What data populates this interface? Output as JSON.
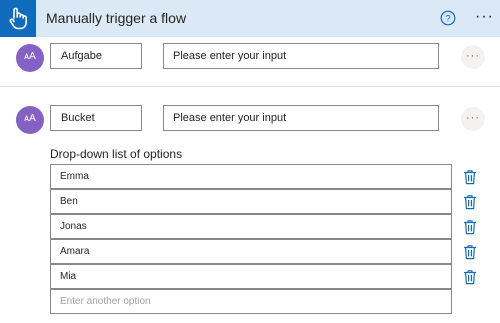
{
  "header": {
    "title": "Manually trigger a flow",
    "trigger_icon": "touch-hand-icon",
    "help_icon": "help-circle-icon",
    "more_label": "···"
  },
  "inputs": [
    {
      "avatar_text": "ᴀA",
      "label": "Aufgabe",
      "placeholder": "Please enter your input",
      "more_label": "···"
    },
    {
      "avatar_text": "ᴀA",
      "label": "Bucket",
      "placeholder": "Please enter your input",
      "more_label": "···"
    }
  ],
  "dropdown": {
    "heading": "Drop-down list of options",
    "options": [
      "Emma",
      "Ben",
      "Jonas",
      "Amara",
      "Mia"
    ],
    "new_option_placeholder": "Enter another option",
    "delete_icon": "trash-icon"
  },
  "colors": {
    "header_bg": "#dbe9f7",
    "brand_blue": "#0f6cbd",
    "avatar_purple": "#8661c5"
  }
}
